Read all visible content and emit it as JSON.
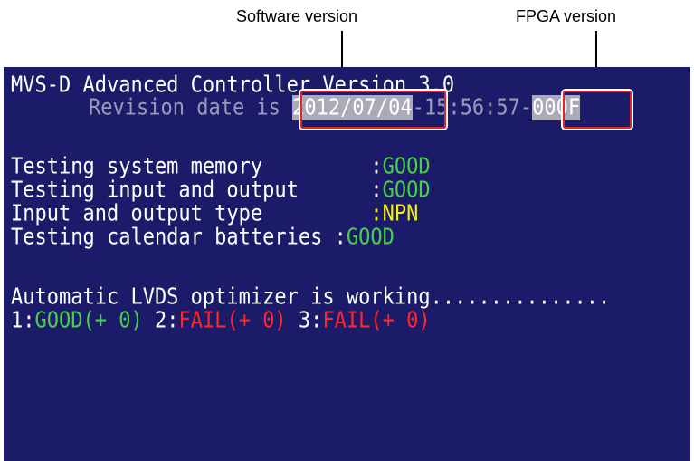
{
  "callouts": {
    "software": "Software version",
    "fpga": "FPGA version"
  },
  "console": {
    "title": "MVS-D Advanced Controller Version 3.0",
    "revision_prefix": "Revision date is ",
    "revision_date": "2012/07/04",
    "revision_time": "-15:56:57-",
    "fpga_code": "000F",
    "tests": [
      {
        "label": "Testing system memory         ",
        "sep": ":",
        "status": "GOOD"
      },
      {
        "label": "Testing input and output      ",
        "sep": ":",
        "status": "GOOD"
      },
      {
        "label": "Input and output type         ",
        "sep": ":",
        "status": "NPN"
      },
      {
        "label": "Testing calendar batteries ",
        "sep": ":",
        "status": "GOOD"
      }
    ],
    "optimizer_text": "Automatic LVDS optimizer is working...............",
    "lvds": [
      {
        "index": "1:",
        "status": "GOOD",
        "offset": "(+ 0)"
      },
      {
        "index": " 2:",
        "status": "FAIL",
        "offset": "(+ 0)"
      },
      {
        "index": " 3:",
        "status": "FAIL",
        "offset": "(+ 0)"
      }
    ]
  },
  "colors": {
    "screen_bg": "#1b1b6a",
    "good": "#48d048",
    "fail": "#ff2828",
    "npn": "#f2f20a",
    "highlight_border": "#e52424"
  }
}
